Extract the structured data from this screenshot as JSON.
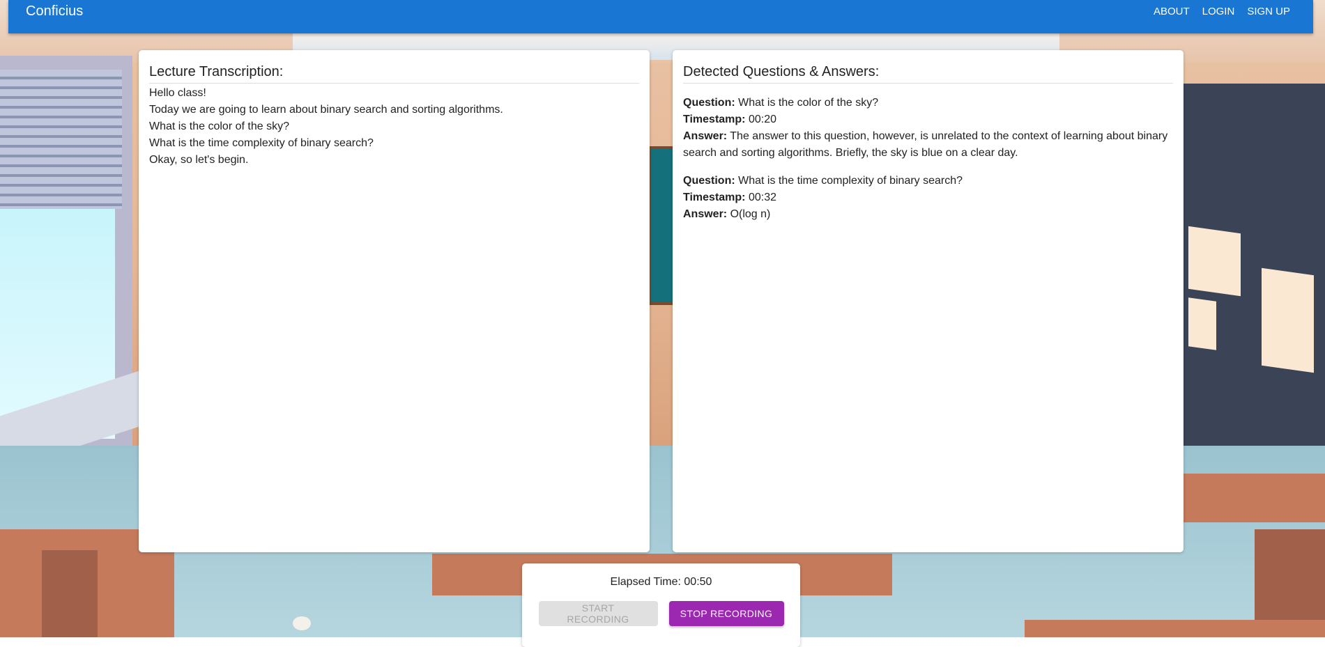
{
  "appbar": {
    "brand": "Conficius",
    "nav": [
      "ABOUT",
      "LOGIN",
      "SIGN UP"
    ],
    "color": "#1976d2"
  },
  "transcription": {
    "title": "Lecture Transcription:",
    "lines": [
      "Hello class!",
      "Today we are going to learn about binary search and sorting algorithms.",
      "What is the color of the sky?",
      "What is the time complexity of binary search?",
      "Okay, so let's begin."
    ]
  },
  "qa": {
    "title": "Detected Questions & Answers:",
    "labels": {
      "question": "Question:",
      "timestamp": "Timestamp:",
      "answer": "Answer:"
    },
    "items": [
      {
        "question": "What is the color of the sky?",
        "timestamp": "00:20",
        "answer": "The answer to this question, however, is unrelated to the context of learning about binary search and sorting algorithms. Briefly, the sky is blue on a clear day."
      },
      {
        "question": "What is the time complexity of binary search?",
        "timestamp": "00:32",
        "answer": "O(log n)"
      }
    ]
  },
  "controls": {
    "elapsed_label": "Elapsed Time:",
    "elapsed_value": "00:50",
    "elapsed_text": "Elapsed Time: 00:50",
    "start_label": "START RECORDING",
    "start_disabled": true,
    "stop_label": "STOP RECORDING",
    "stop_color": "#9c27b0"
  }
}
